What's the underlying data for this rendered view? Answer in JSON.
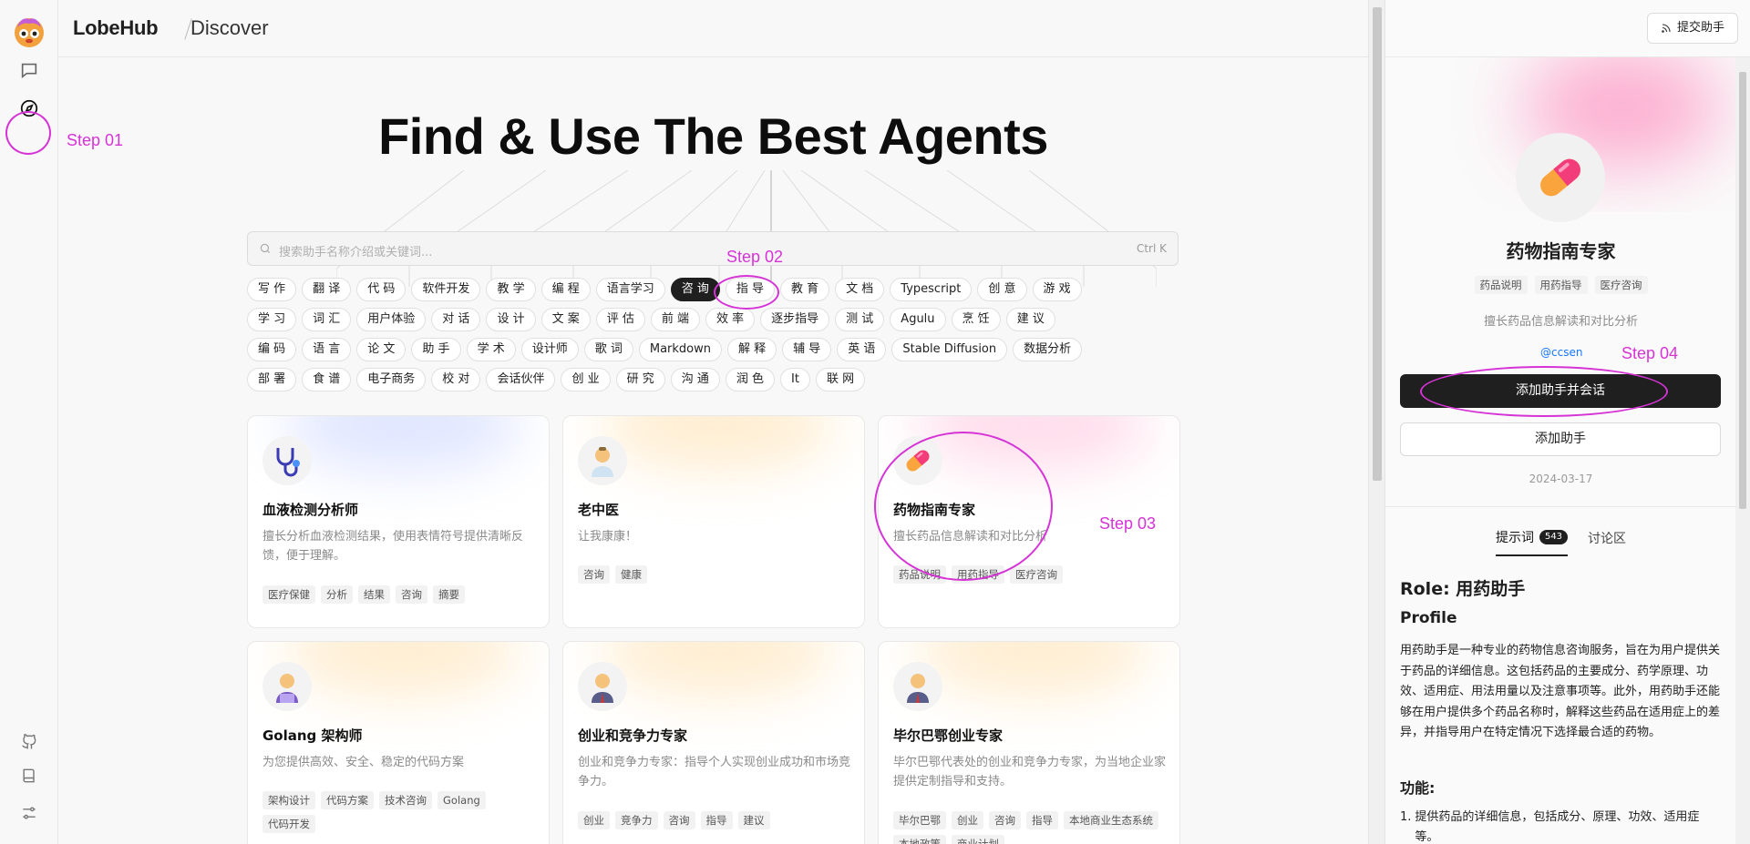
{
  "header": {
    "brand": "LobeHub",
    "section": "Discover"
  },
  "hero": {
    "title": "Find & Use The Best Agents"
  },
  "search": {
    "placeholder": "搜索助手名称介绍或关键词...",
    "shortcut": "Ctrl K"
  },
  "tag_rows": [
    [
      "写 作",
      "翻 译",
      "代 码",
      "软件开发",
      "教 学",
      "编 程",
      "语言学习",
      "咨 询",
      "指 导",
      "教 育",
      "文 档",
      "Typescript",
      "创 意",
      "游 戏"
    ],
    [
      "学 习",
      "词 汇",
      "用户体验",
      "对 话",
      "设 计",
      "文 案",
      "评 估",
      "前 端",
      "效 率",
      "逐步指导",
      "测 试",
      "Agulu",
      "烹 饪",
      "建 议"
    ],
    [
      "编 码",
      "语 言",
      "论 文",
      "助 手",
      "学 术",
      "设计师",
      "歌 词",
      "Markdown",
      "解 释",
      "辅 导",
      "英 语",
      "Stable Diffusion",
      "数据分析"
    ],
    [
      "部 署",
      "食 谱",
      "电子商务",
      "校 对",
      "会话伙伴",
      "创 业",
      "研 究",
      "沟 通",
      "润 色",
      "It",
      "联 网"
    ]
  ],
  "active_tag": "咨 询",
  "cards": [
    {
      "title": "血液检测分析师",
      "desc": "擅长分析血液检测结果，使用表情符号提供清晰反馈，便于理解。",
      "tags": [
        "医疗保健",
        "分析",
        "结果",
        "咨询",
        "摘要"
      ],
      "glow": "#b9c7ff",
      "icon": "stethoscope-icon"
    },
    {
      "title": "老中医",
      "desc": "让我康康！",
      "tags": [
        "咨询",
        "健康"
      ],
      "glow": "#ffd89a",
      "icon": "doctor-icon"
    },
    {
      "title": "药物指南专家",
      "desc": "擅长药品信息解读和对比分析",
      "tags": [
        "药品说明",
        "用药指导",
        "医疗咨询"
      ],
      "glow": "#ffb3d3",
      "icon": "pill-icon"
    },
    {
      "title": "Golang 架构师",
      "desc": "为您提供高效、安全、稳定的代码方案",
      "tags": [
        "架构设计",
        "代码方案",
        "技术咨询",
        "Golang",
        "代码开发"
      ],
      "glow": "#ffd89a",
      "icon": "technologist-icon"
    },
    {
      "title": "创业和竞争力专家",
      "desc": "创业和竞争力专家：指导个人实现创业成功和市场竞争力。",
      "tags": [
        "创业",
        "竞争力",
        "咨询",
        "指导",
        "建议"
      ],
      "glow": "#ffd89a",
      "icon": "businessman-icon"
    },
    {
      "title": "毕尔巴鄂创业专家",
      "desc": "毕尔巴鄂代表处的创业和竞争力专家，为当地企业家提供定制指导和支持。",
      "tags": [
        "毕尔巴鄂",
        "创业",
        "咨询",
        "指导",
        "本地商业生态系统",
        "本地政策",
        "商业计划"
      ],
      "glow": "#ffd89a",
      "icon": "businessman-icon"
    }
  ],
  "steps": {
    "s1": "Step 01",
    "s2": "Step 02",
    "s3": "Step 03",
    "s4": "Step 04"
  },
  "panel": {
    "submit": "提交助手",
    "title": "药物指南专家",
    "tags": [
      "药品说明",
      "用药指导",
      "医疗咨询"
    ],
    "desc": "擅长药品信息解读和对比分析",
    "author": "@ccsen",
    "primary": "添加助手并会话",
    "secondary": "添加助手",
    "date": "2024-03-17",
    "tab_prompt": "提示词",
    "tab_prompt_count": "543",
    "tab_discuss": "讨论区",
    "role": "Role: 用药助手",
    "profile": "Profile",
    "para": "用药助手是一种专业的药物信息咨询服务，旨在为用户提供关于药品的详细信息。这包括药品的主要成分、药学原理、功效、适用症、用法用量以及注意事项等。此外，用药助手还能够在用户提供多个药品名称时，解释这些药品在适用症上的差异，并指导用户在特定情况下选择最合适的药物。",
    "func": "功能:",
    "li_num": "1.",
    "li1": "提供药品的详细信息，包括成分、原理、功效、适用症等。"
  },
  "colors": {
    "accent": "#d633d6",
    "primary_btn": "#1f1f1f",
    "link": "#1677ff"
  }
}
